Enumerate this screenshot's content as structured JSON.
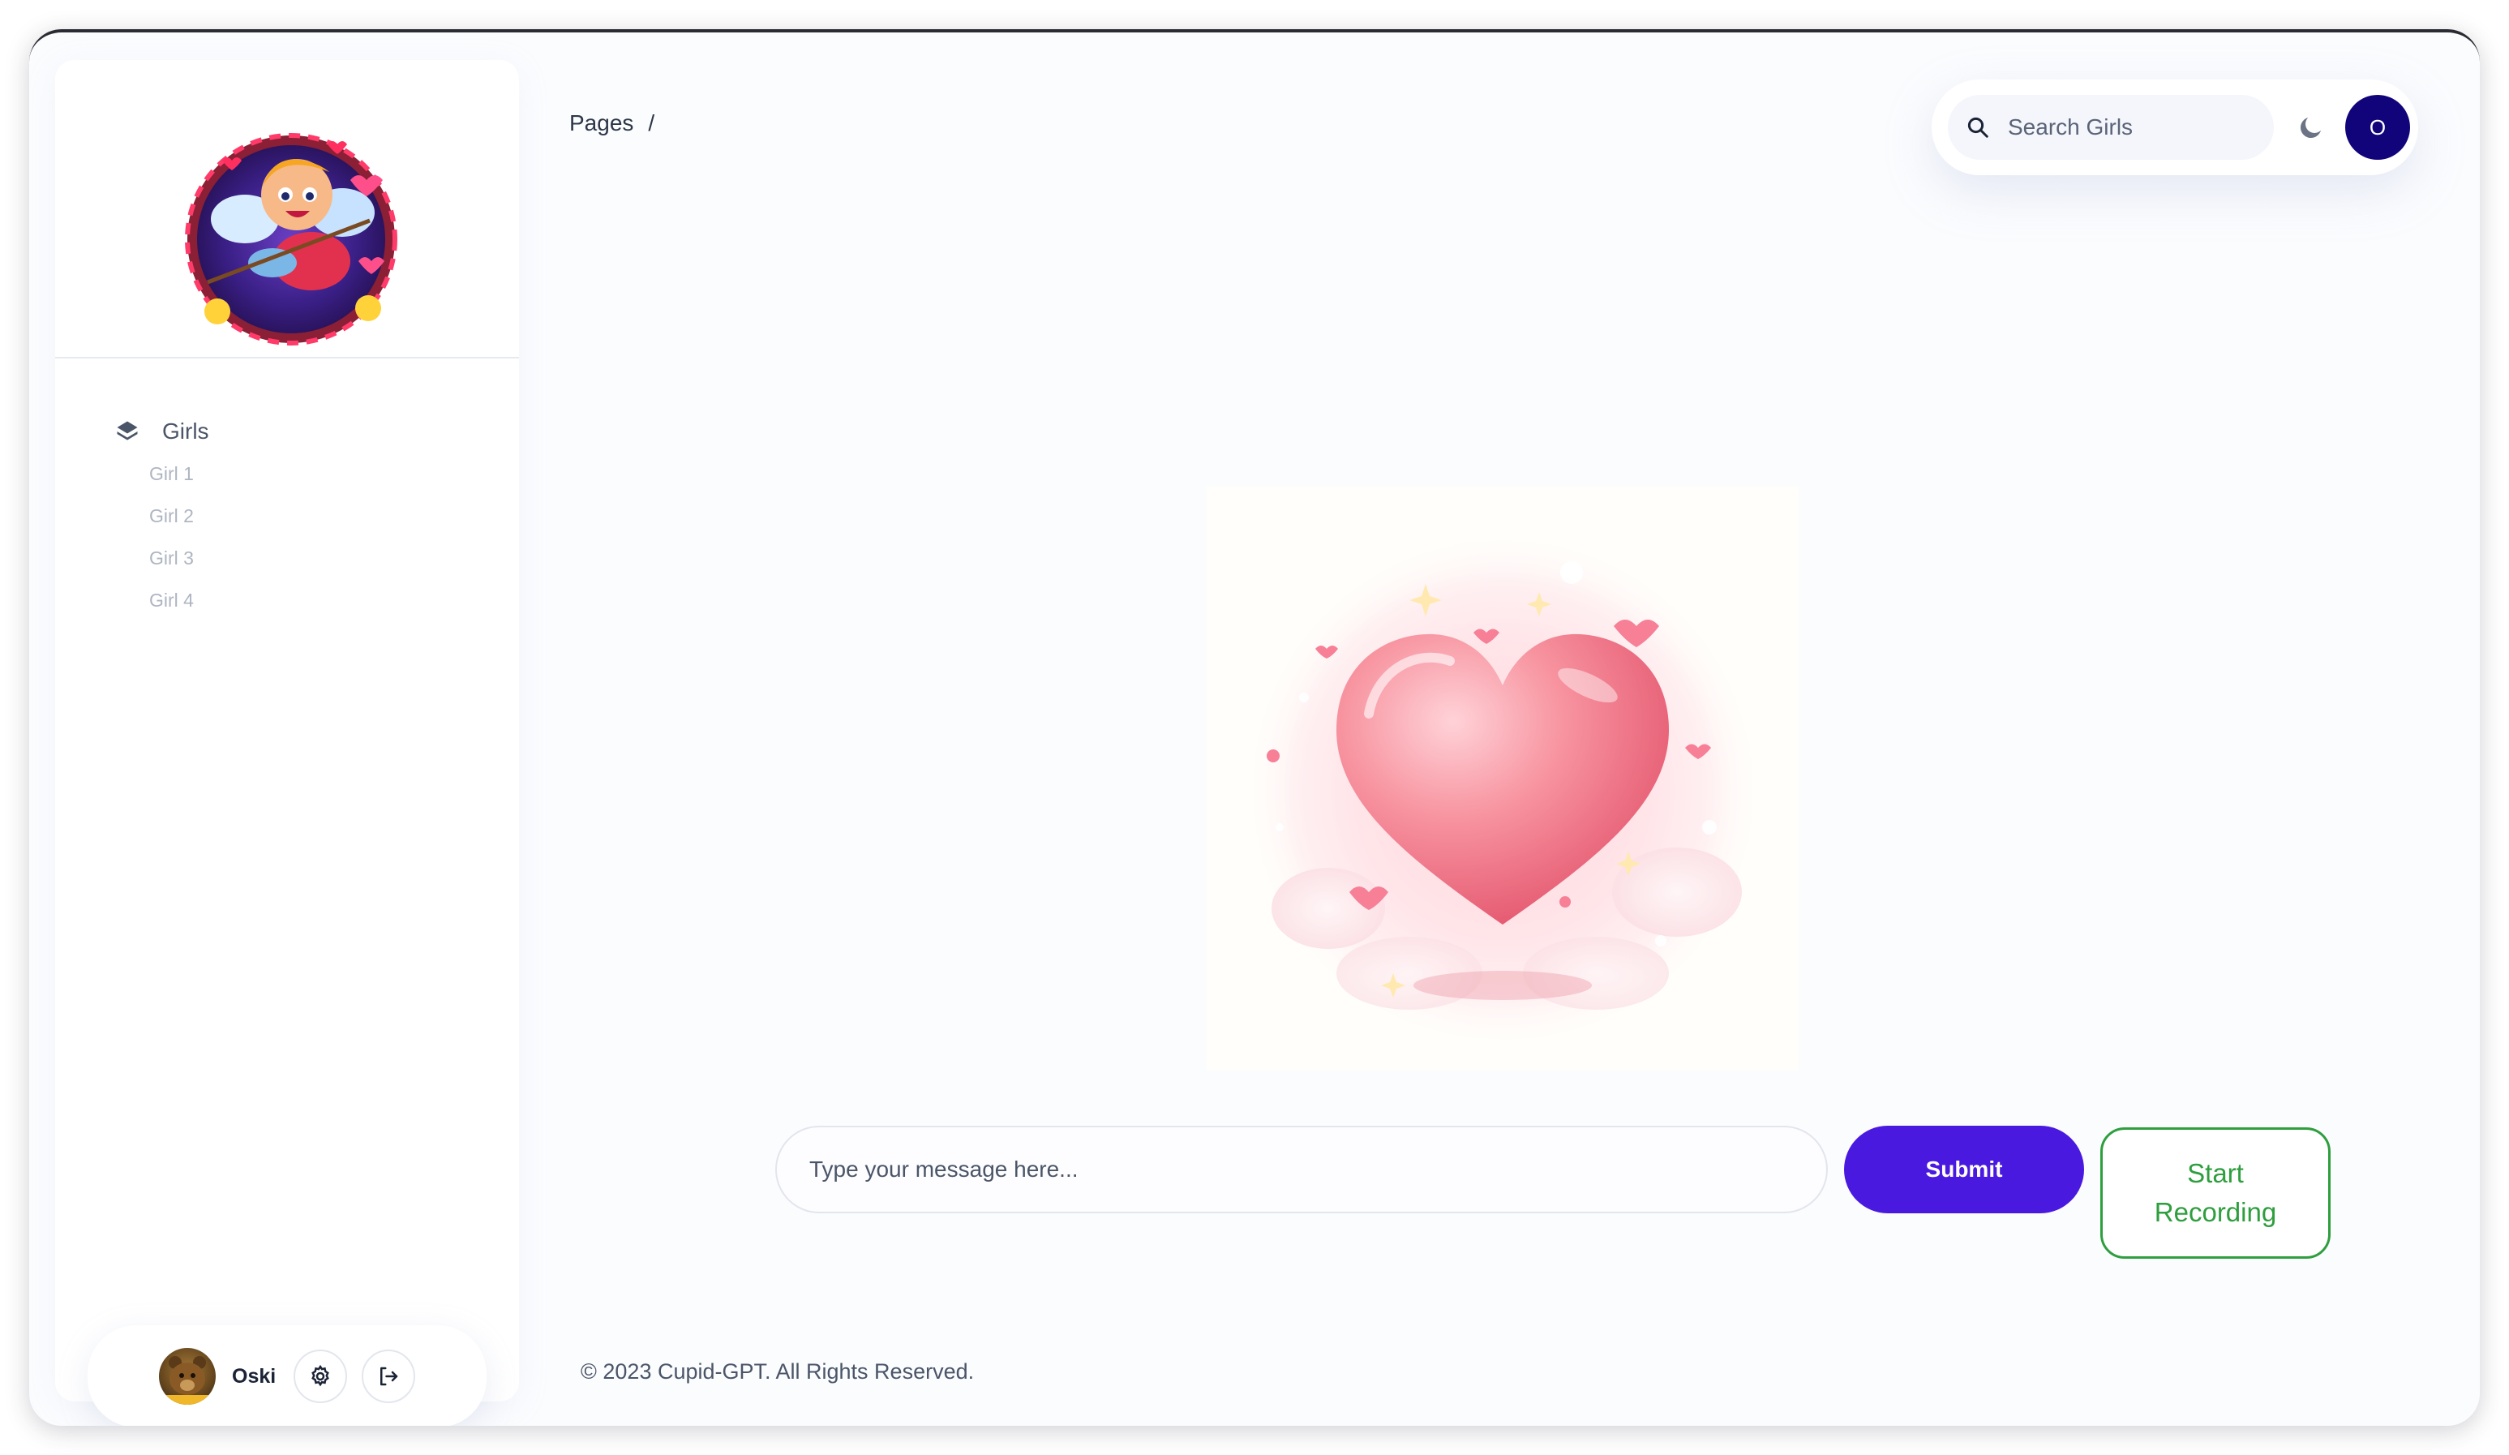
{
  "header": {
    "breadcrumb_root": "Pages",
    "breadcrumb_sep": "/"
  },
  "search": {
    "placeholder": "Search Girls"
  },
  "profile": {
    "initial": "O"
  },
  "sidebar": {
    "section_label": "Girls",
    "items": [
      {
        "label": "Girl 1"
      },
      {
        "label": "Girl 2"
      },
      {
        "label": "Girl 3"
      },
      {
        "label": "Girl 4"
      }
    ],
    "user": {
      "name": "Oski"
    }
  },
  "chat": {
    "input_placeholder": "Type your message here...",
    "submit_label": "Submit",
    "record_label": "Start Recording"
  },
  "footer": {
    "text": "© 2023 Cupid-GPT. All Rights Reserved."
  },
  "colors": {
    "accent": "#4a19e0",
    "profile_bg": "#11047a",
    "record": "#2e9e3e"
  }
}
